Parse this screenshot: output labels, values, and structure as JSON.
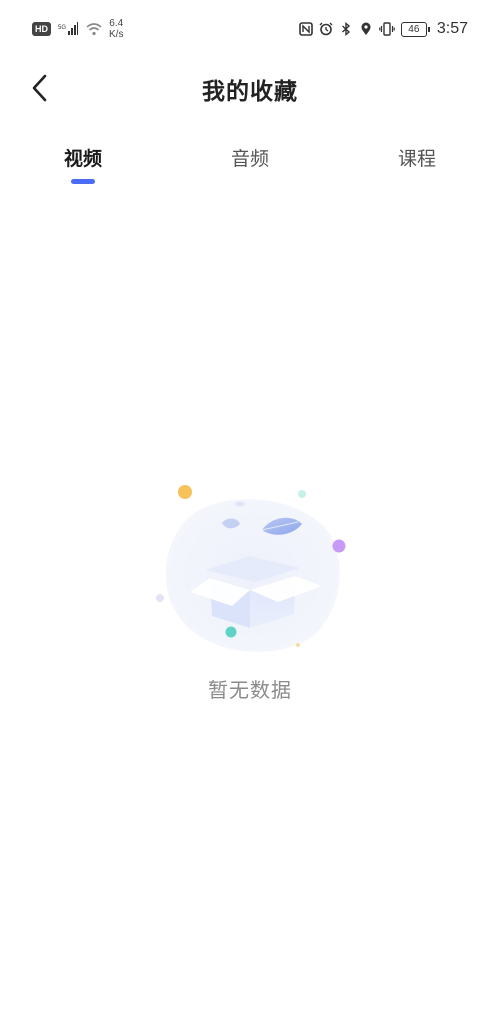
{
  "status_bar": {
    "hd_badge": "HD",
    "network_speed_value": "6.4",
    "network_speed_unit": "K/s",
    "battery": "46",
    "time": "3:57",
    "icons": [
      "hd-icon",
      "signal-5g-icon",
      "wifi-icon",
      "nfc-icon",
      "alarm-icon",
      "bluetooth-icon",
      "location-icon",
      "vibrate-icon",
      "battery-icon"
    ]
  },
  "nav": {
    "title": "我的收藏",
    "back_icon": "chevron-left-icon"
  },
  "tabs": [
    {
      "label": "视频",
      "active": true
    },
    {
      "label": "音频",
      "active": false
    },
    {
      "label": "课程",
      "active": false
    }
  ],
  "empty_state": {
    "message": "暂无数据",
    "illustration": "empty-box-icon"
  },
  "colors": {
    "accent": "#4a6cf7",
    "title": "#222222",
    "empty_text": "#8a8a8a",
    "background": "#ffffff"
  }
}
